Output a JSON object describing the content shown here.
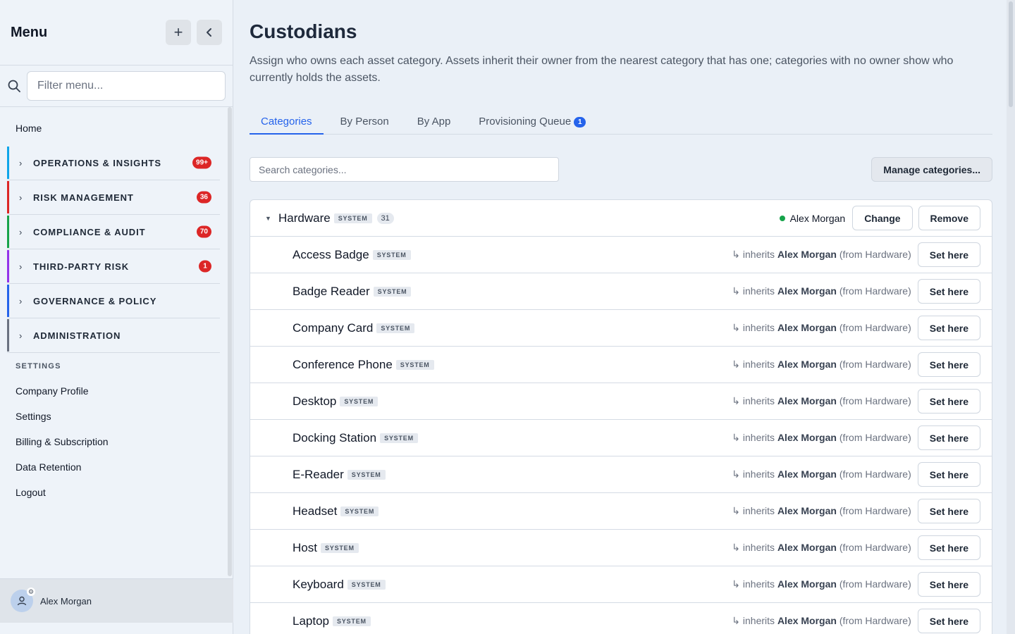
{
  "sidebar": {
    "title": "Menu",
    "add_icon": "+",
    "collapse_icon": "‹",
    "filter_placeholder": "Filter menu...",
    "home": "Home",
    "groups": [
      {
        "label": "OPERATIONS & INSIGHTS",
        "badge": "99+",
        "color": "#0ea5e9"
      },
      {
        "label": "RISK MANAGEMENT",
        "badge": "36",
        "color": "#dc2626"
      },
      {
        "label": "COMPLIANCE & AUDIT",
        "badge": "70",
        "color": "#16a34a"
      },
      {
        "label": "THIRD-PARTY RISK",
        "badge": "1",
        "color": "#9333ea"
      },
      {
        "label": "GOVERNANCE & POLICY",
        "badge": "",
        "color": "#2563eb"
      },
      {
        "label": "ADMINISTRATION",
        "badge": "",
        "color": "#6b7280"
      }
    ],
    "settings_heading": "SETTINGS",
    "links": [
      "Company Profile",
      "Settings",
      "Billing & Subscription",
      "Data Retention",
      "Logout"
    ],
    "user_name": "Alex Morgan"
  },
  "main": {
    "title": "Custodians",
    "description": "Assign who owns each asset category. Assets inherit their owner from the nearest category that has one; categories with no owner show who currently holds the assets.",
    "tabs": [
      {
        "label": "Categories",
        "badge": ""
      },
      {
        "label": "By Person",
        "badge": ""
      },
      {
        "label": "By App",
        "badge": ""
      },
      {
        "label": "Provisioning Queue",
        "badge": "1"
      }
    ],
    "search_placeholder": "Search categories...",
    "manage_label": "Manage categories...",
    "parent": {
      "name": "Hardware",
      "tag": "SYSTEM",
      "count": "31",
      "owner": "Alex Morgan",
      "change_label": "Change",
      "remove_label": "Remove"
    },
    "inherit_prefix": "↳ inherits",
    "inherit_owner": "Alex Morgan",
    "inherit_from": "(from Hardware)",
    "set_label": "Set here",
    "children": [
      {
        "name": "Access Badge",
        "tag": "SYSTEM"
      },
      {
        "name": "Badge Reader",
        "tag": "SYSTEM"
      },
      {
        "name": "Company Card",
        "tag": "SYSTEM"
      },
      {
        "name": "Conference Phone",
        "tag": "SYSTEM"
      },
      {
        "name": "Desktop",
        "tag": "SYSTEM"
      },
      {
        "name": "Docking Station",
        "tag": "SYSTEM"
      },
      {
        "name": "E-Reader",
        "tag": "SYSTEM"
      },
      {
        "name": "Headset",
        "tag": "SYSTEM"
      },
      {
        "name": "Host",
        "tag": "SYSTEM"
      },
      {
        "name": "Keyboard",
        "tag": "SYSTEM"
      },
      {
        "name": "Laptop",
        "tag": "SYSTEM"
      }
    ]
  }
}
